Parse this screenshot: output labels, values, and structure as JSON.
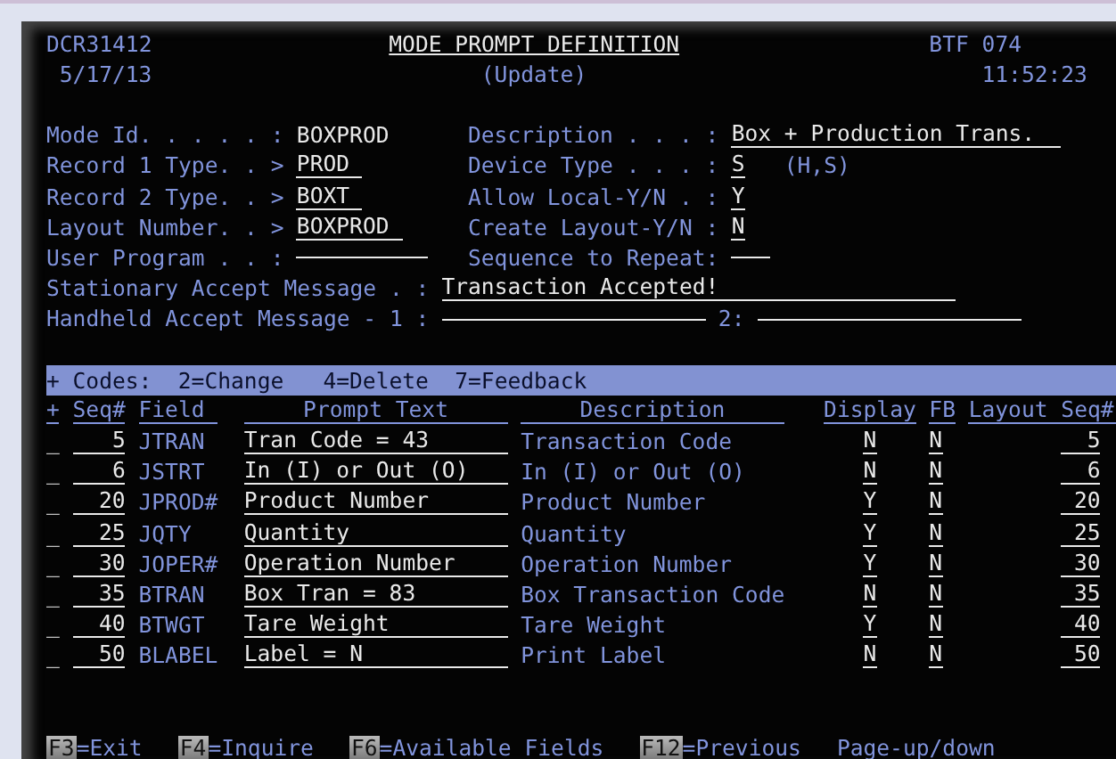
{
  "header": {
    "program": "DCR31412",
    "title": "MODE PROMPT DEFINITION",
    "device": "BTF 074",
    "date": "5/17/13",
    "mode": "(Update)",
    "time": "11:52:23"
  },
  "form_rows": [
    {
      "left": {
        "label": "Mode Id. . . . . :",
        "value": "BOXPROD",
        "editable": false
      },
      "right": {
        "label": "Description . . . :",
        "value": "Box + Production Trans.",
        "editable": true
      }
    },
    {
      "left": {
        "label": "Record 1 Type. . >",
        "value": "PROD",
        "editable": true
      },
      "right": {
        "label": "Device Type . . . :",
        "value": "S",
        "editable": true,
        "hint": "(H,S)"
      }
    },
    {
      "left": {
        "label": "Record 2 Type. . >",
        "value": "BOXT",
        "editable": true
      },
      "right": {
        "label": "Allow Local-Y/N . :",
        "value": "Y",
        "editable": true
      }
    },
    {
      "left": {
        "label": "Layout Number. . >",
        "value": "BOXPROD",
        "editable": true
      },
      "right": {
        "label": "Create Layout-Y/N :",
        "value": "N",
        "editable": true
      }
    },
    {
      "left": {
        "label": "User Program . . :",
        "editable": true
      },
      "right": {
        "label": "Sequence to Repeat:",
        "editable": true
      }
    }
  ],
  "stationary": {
    "label": "Stationary Accept Message . :",
    "value": "Transaction Accepted!"
  },
  "handheld": {
    "label": "Handheld Accept Message - 1 :",
    "second_label": "2:"
  },
  "codes_bar": {
    "marker": "+",
    "label": "Codes:",
    "codes": [
      "2=Change",
      "4=Delete",
      "7=Feedback"
    ]
  },
  "table": {
    "columns": [
      "+",
      "Seq#",
      "Field",
      "Prompt Text",
      "Description",
      "Display",
      "FB",
      "Layout Seq#"
    ],
    "rows": [
      {
        "option": "_",
        "seq": "5",
        "field": "JTRAN",
        "prompt": "Tran Code = 43",
        "description": "Transaction Code",
        "display": "N",
        "fb": "N",
        "layout_seq": "5"
      },
      {
        "option": "_",
        "seq": "6",
        "field": "JSTRT",
        "prompt": "In (I) or Out (O)",
        "description": "In (I) or Out (O)",
        "display": "N",
        "fb": "N",
        "layout_seq": "6"
      },
      {
        "option": "_",
        "seq": "20",
        "field": "JPROD#",
        "prompt": "Product Number",
        "description": "Product Number",
        "display": "Y",
        "fb": "N",
        "layout_seq": "20"
      },
      {
        "option": "_",
        "seq": "25",
        "field": "JQTY",
        "prompt": "Quantity",
        "description": "Quantity",
        "display": "Y",
        "fb": "N",
        "layout_seq": "25"
      },
      {
        "option": "_",
        "seq": "30",
        "field": "JOPER#",
        "prompt": "Operation Number",
        "description": "Operation Number",
        "display": "Y",
        "fb": "N",
        "layout_seq": "30"
      },
      {
        "option": "_",
        "seq": "35",
        "field": "BTRAN",
        "prompt": "Box Tran = 83",
        "description": "Box Transaction Code",
        "display": "N",
        "fb": "N",
        "layout_seq": "35"
      },
      {
        "option": "_",
        "seq": "40",
        "field": "BTWGT",
        "prompt": "Tare Weight",
        "description": "Tare Weight",
        "display": "Y",
        "fb": "N",
        "layout_seq": "40"
      },
      {
        "option": "_",
        "seq": "50",
        "field": "BLABEL",
        "prompt": "Label = N",
        "description": "Print Label",
        "display": "N",
        "fb": "N",
        "layout_seq": "50"
      }
    ]
  },
  "function_keys": [
    {
      "key": "F3",
      "label": "=Exit"
    },
    {
      "key": "F4",
      "label": "=Inquire"
    },
    {
      "key": "F6",
      "label": "=Available Fields"
    },
    {
      "key": "F12",
      "label": "=Previous"
    },
    {
      "label": "Page-up/down"
    }
  ]
}
